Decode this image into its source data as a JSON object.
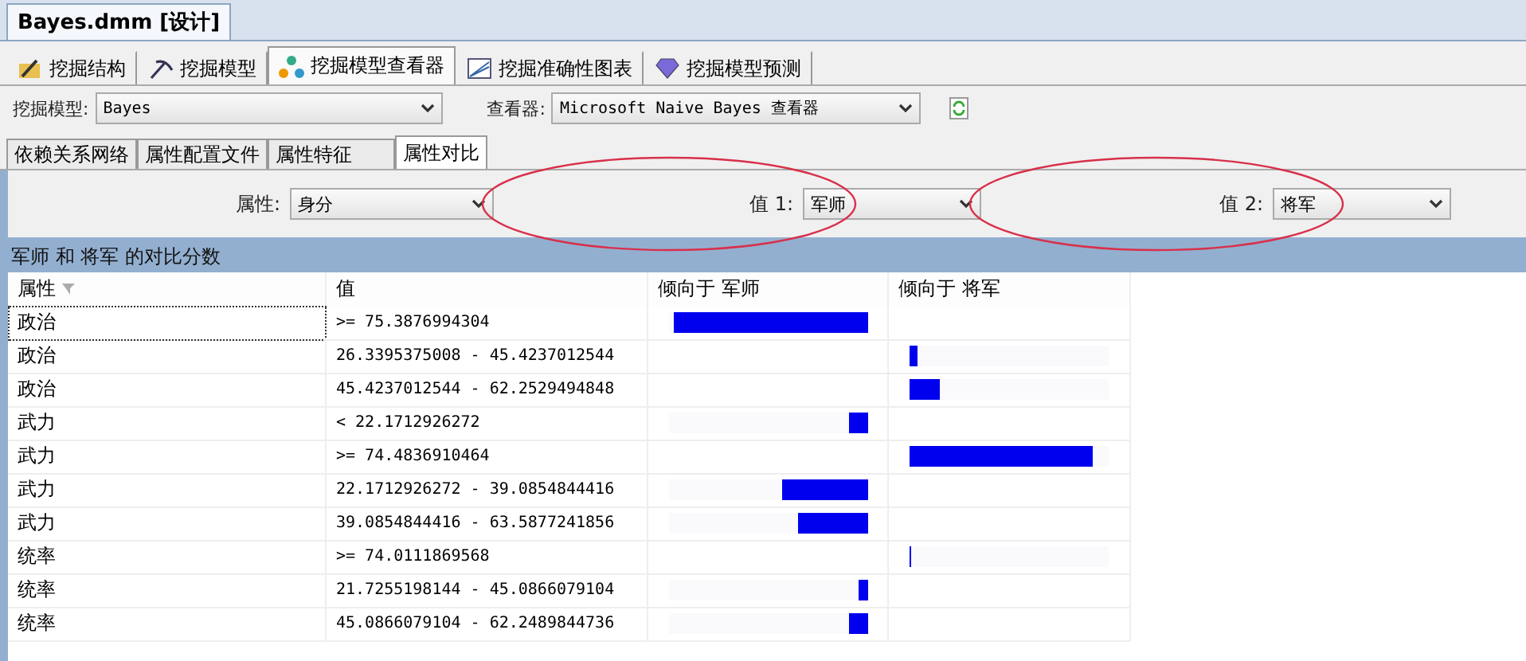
{
  "document_tab": {
    "title": "Bayes.dmm [设计]"
  },
  "tabs": [
    {
      "label": "挖掘结构",
      "selected": false
    },
    {
      "label": "挖掘模型",
      "selected": false
    },
    {
      "label": "挖掘模型查看器",
      "selected": true
    },
    {
      "label": "挖掘准确性图表",
      "selected": false
    },
    {
      "label": "挖掘模型预测",
      "selected": false
    }
  ],
  "toolbar": {
    "model_label": "挖掘模型:",
    "model_value": "Bayes",
    "viewer_label": "查看器:",
    "viewer_value": "Microsoft Naive Bayes 查看器"
  },
  "sub_tabs": [
    {
      "label": "依赖关系网络",
      "selected": false
    },
    {
      "label": "属性配置文件",
      "selected": false
    },
    {
      "label": "属性特征",
      "selected": false
    },
    {
      "label": "属性对比",
      "selected": true
    }
  ],
  "filters": [
    {
      "label": "属性:",
      "value": "身分",
      "circled": false
    },
    {
      "label": "值 1:",
      "value": "军师",
      "circled": true
    },
    {
      "label": "值 2:",
      "value": "将军",
      "circled": true
    }
  ],
  "panel_title": "军师 和 将军 的对比分数",
  "table": {
    "columns": [
      "属性",
      "值",
      "倾向于 军师",
      "倾向于 将军"
    ],
    "rows": [
      {
        "attribute": "政治",
        "value": ">= 75.3876994304",
        "focused": true,
        "bar": {
          "kind": "favors_1",
          "level": 0.98
        }
      },
      {
        "attribute": "政治",
        "value": "26.3395375008 - 45.4237012544",
        "focused": false,
        "bar": {
          "kind": "favors_2",
          "level": 0.04
        }
      },
      {
        "attribute": "政治",
        "value": "45.4237012544 - 62.2529494848",
        "focused": false,
        "bar": {
          "kind": "favors_2",
          "level": 0.15
        }
      },
      {
        "attribute": "武力",
        "value": "< 22.1712926272",
        "focused": false,
        "bar": {
          "kind": "favors_1",
          "level": 0.1
        }
      },
      {
        "attribute": "武力",
        "value": ">= 74.4836910464",
        "focused": false,
        "bar": {
          "kind": "favors_2",
          "level": 0.92
        }
      },
      {
        "attribute": "武力",
        "value": "22.1712926272 - 39.0854844416",
        "focused": false,
        "bar": {
          "kind": "favors_1",
          "level": 0.43
        }
      },
      {
        "attribute": "武力",
        "value": "39.0854844416 - 63.5877241856",
        "focused": false,
        "bar": {
          "kind": "favors_1",
          "level": 0.35
        }
      },
      {
        "attribute": "统率",
        "value": ">= 74.0111869568",
        "focused": false,
        "bar": {
          "kind": "favors_2",
          "level": 0.01
        }
      },
      {
        "attribute": "统率",
        "value": "21.7255198144 - 45.0866079104",
        "focused": false,
        "bar": {
          "kind": "favors_1",
          "level": 0.05
        }
      },
      {
        "attribute": "统率",
        "value": "45.0866079104 - 62.2489844736",
        "focused": false,
        "bar": {
          "kind": "favors_1",
          "level": 0.1
        }
      }
    ]
  }
}
